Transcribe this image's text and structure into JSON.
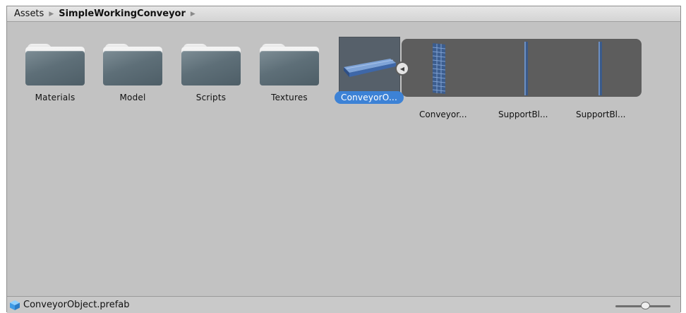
{
  "breadcrumb": {
    "items": [
      "Assets",
      "SimpleWorkingConveyor"
    ]
  },
  "assets": {
    "folders": [
      {
        "label": "Materials",
        "icon": "folder-icon"
      },
      {
        "label": "Model",
        "icon": "folder-icon"
      },
      {
        "label": "Scripts",
        "icon": "folder-icon"
      },
      {
        "label": "Textures",
        "icon": "folder-icon"
      }
    ],
    "selected": {
      "label": "ConveyorO...",
      "icon": "prefab-thumbnail"
    },
    "subassets": [
      {
        "label": "Conveyor...",
        "icon": "mesh-thumbnail"
      },
      {
        "label": "SupportBl...",
        "icon": "mesh-thumbnail"
      },
      {
        "label": "SupportBl...",
        "icon": "mesh-thumbnail"
      }
    ]
  },
  "statusbar": {
    "selected_path": "ConveyorObject.prefab",
    "icon": "prefab-cube-icon",
    "zoom": 0.55
  },
  "colors": {
    "selection": "#3d82d6",
    "panel": "#c2c2c2",
    "subasset_bg": "#5d5d5d"
  }
}
